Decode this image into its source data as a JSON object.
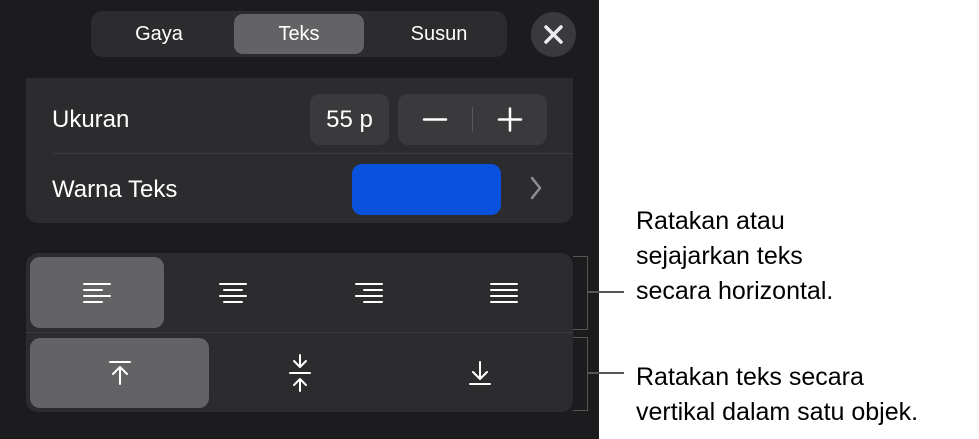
{
  "tabs": [
    {
      "label": "Gaya"
    },
    {
      "label": "Teks"
    },
    {
      "label": "Susun"
    }
  ],
  "active_tab": "Teks",
  "size": {
    "label": "Ukuran",
    "value": "55 p"
  },
  "text_color": {
    "label": "Warna Teks",
    "swatch": "#0a52dd"
  },
  "horizontal_alignment": {
    "options": [
      "left",
      "center",
      "right",
      "justify"
    ],
    "selected": "left"
  },
  "vertical_alignment": {
    "options": [
      "top",
      "middle",
      "bottom"
    ],
    "selected": "top"
  },
  "callouts": {
    "horizontal": "Ratakan atau\nsejajarkan teks\nsecara horizontal.",
    "vertical": "Ratakan teks secara\nvertikal dalam satu objek."
  },
  "colors": {
    "panel": "#1c1c1e",
    "card": "#2c2c2e",
    "control": "#3a3a3c",
    "selected": "#636366",
    "swatch": "#0a52dd"
  }
}
